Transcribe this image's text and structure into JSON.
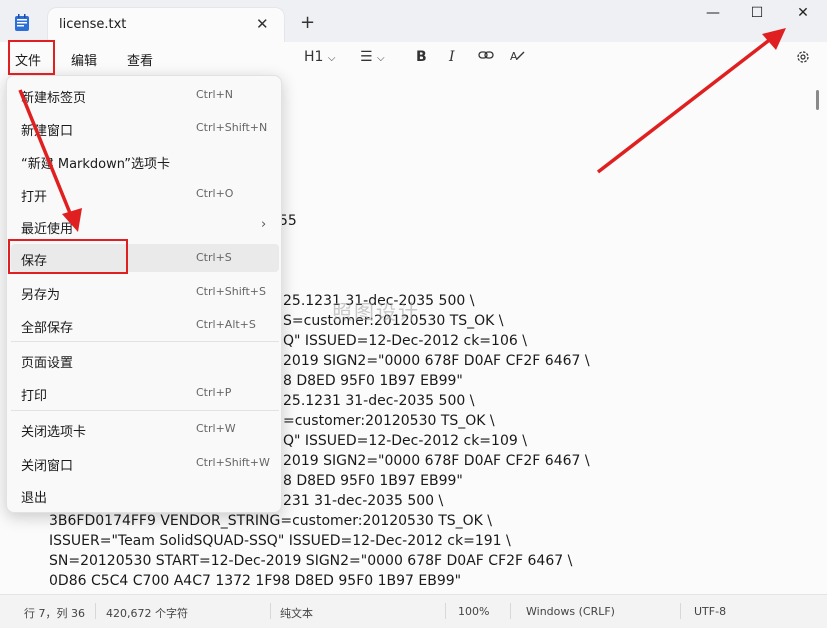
{
  "window": {
    "tab_title": "license.txt",
    "tab_close": "✕",
    "new_tab": "+",
    "minimize": "—",
    "maximize": "☐",
    "close": "✕"
  },
  "menubar": {
    "items": [
      "文件",
      "编辑",
      "查看"
    ],
    "heading": "H1",
    "bold": "B",
    "italic": "I"
  },
  "file_menu": {
    "items": [
      {
        "label": "新建标签页",
        "shortcut": "Ctrl+N"
      },
      {
        "label": "新建窗口",
        "shortcut": "Ctrl+Shift+N"
      },
      {
        "label": "“新建 Markdown”选项卡",
        "shortcut": ""
      },
      {
        "label": "打开",
        "shortcut": "Ctrl+O"
      },
      {
        "label": "最近使用",
        "shortcut": "",
        "submenu": true
      },
      {
        "label": "保存",
        "shortcut": "Ctrl+S"
      },
      {
        "label": "另存为",
        "shortcut": "Ctrl+Shift+S"
      },
      {
        "label": "全部保存",
        "shortcut": "Ctrl+Alt+S"
      },
      {
        "label": "页面设置",
        "shortcut": ""
      },
      {
        "label": "打印",
        "shortcut": "Ctrl+P"
      },
      {
        "label": "关闭选项卡",
        "shortcut": "Ctrl+W"
      },
      {
        "label": "关闭窗口",
        "shortcut": "Ctrl+Shift+W"
      },
      {
        "label": "退出",
        "shortcut": ""
      }
    ]
  },
  "document": {
    "lines": [
      "55",
      "25.1231 31-dec-2035 500 \\",
      "S=customer:20120530 TS_OK \\",
      "Q\" ISSUED=12-Dec-2012 ck=106 \\",
      "2019 SIGN2=\"0000 678F D0AF CF2F 6467 \\",
      "8 D8ED 95F0 1B97 EB99\"",
      "25.1231 31-dec-2035 500 \\",
      "=customer:20120530 TS_OK \\",
      "Q\" ISSUED=12-Dec-2012 ck=109 \\",
      "2019 SIGN2=\"0000 678F D0AF CF2F 6467 \\",
      "8 D8ED 95F0 1B97 EB99\"",
      "231 31-dec-2035 500 \\",
      "3B6FD0174FF9 VENDOR_STRING=customer:20120530 TS_OK \\",
      "ISSUER=\"Team SolidSQUAD-SSQ\" ISSUED=12-Dec-2012 ck=191 \\",
      "SN=20120530 START=12-Dec-2019 SIGN2=\"0000 678F D0AF CF2F 6467 \\",
      "0D86 C5C4 C700 A4C7 1372 1F98 D8ED 95F0 1B97 EB99\""
    ],
    "watermark": "照图设计"
  },
  "statusbar": {
    "position": "行 7，列 36",
    "chars": "420,672 个字符",
    "format": "纯文本",
    "zoom": "100%",
    "line_ending": "Windows (CRLF)",
    "encoding": "UTF-8"
  },
  "colors": {
    "annotation": "#e02020"
  }
}
